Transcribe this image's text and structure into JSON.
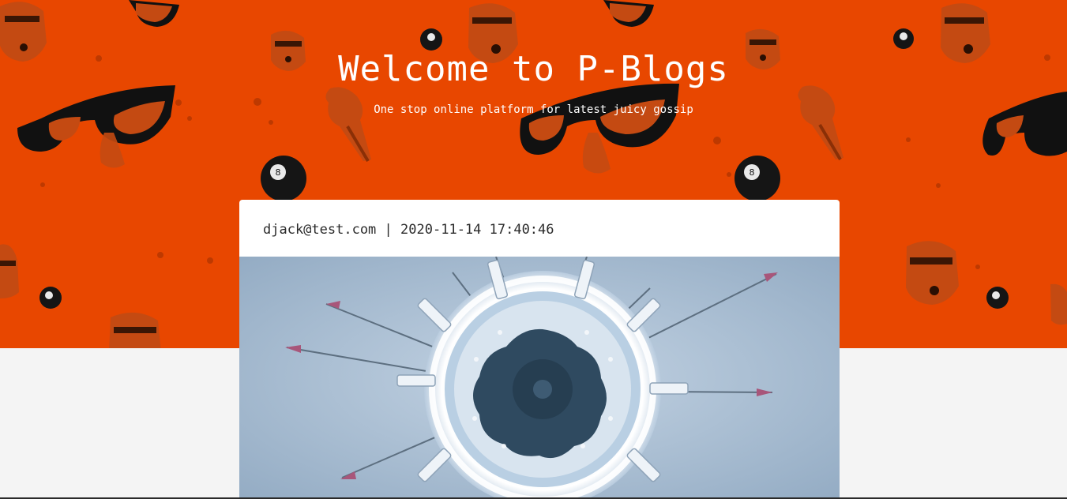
{
  "hero": {
    "title": "Welcome to P-Blogs",
    "subtitle": "One stop online platform for latest juicy gossip",
    "background_color": "#e84700"
  },
  "post": {
    "author": "djack@test.com",
    "separator": "|",
    "timestamp": "2020-11-14 17:40:46",
    "image_icon": "syringes-circle-image"
  },
  "icons": {
    "pattern": [
      "stormtrooper-helmet-icon",
      "sunglasses-nose-icon",
      "eight-ball-icon",
      "ice-cream-cone-icon"
    ]
  }
}
